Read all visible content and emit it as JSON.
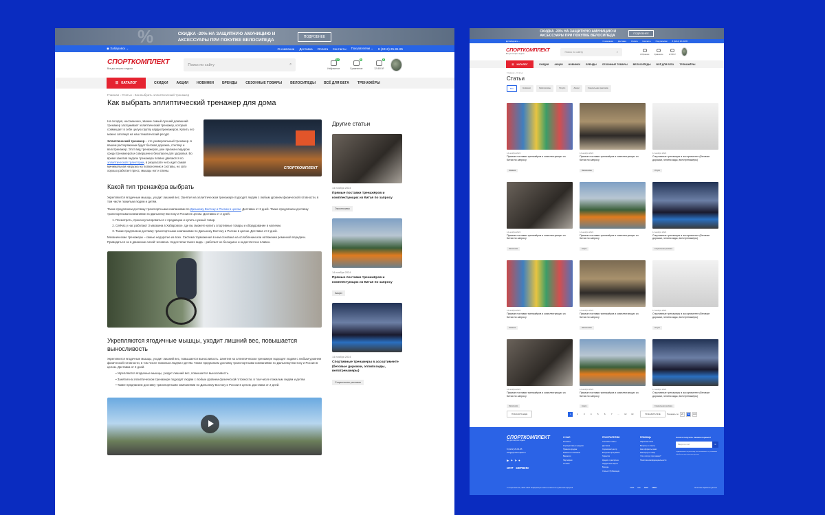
{
  "promo": {
    "text": "СКИДКА -20% НА ЗАЩИТНУЮ АМУНИЦИЮ И АКСЕССУАРЫ ПРИ ПОКУПКЕ ВЕЛОСИПЕДА",
    "button": "ПОДРОБНЕЕ"
  },
  "topbar": {
    "city": "Хабаровск",
    "links": [
      "О компании",
      "Доставка",
      "Оплата",
      "Контакты",
      "Покупателям"
    ],
    "phone": "8 (4212) 25-81-85"
  },
  "header": {
    "logo": "СПОРТКОМПЛЕКТ",
    "slogan": "Все для спорта и отдыха",
    "search_placeholder": "Поиск по сайту",
    "icons": [
      {
        "label": "Избранное",
        "count": "12"
      },
      {
        "label": "Сравнение",
        "count": "8"
      },
      {
        "label": "12 800 ₽",
        "count": "8"
      }
    ]
  },
  "nav": {
    "catalog": "КАТАЛОГ",
    "items": [
      "СКИДКИ",
      "АКЦИИ",
      "НОВИНКИ",
      "БРЕНДЫ",
      "СЕЗОННЫЕ ТОВАРЫ",
      "ВЕЛОСИПЕДЫ",
      "ВСЁ ДЛЯ БЕГА",
      "ТРЕНАЖЁРЫ"
    ]
  },
  "article": {
    "crumbs": "Главная  ›  Статьи  ›  Как выбрать эллиптический тренажер",
    "title": "Как выбрать эллиптический тренажер для дома",
    "intro1": "На сегодня, несомненно, звание самый лучший домашний тренажер заслуживает эллиптический тренажер, который совмещает в себе целую группу кардиотренажеров. Купить его можно заглянув на наш тематический ресурс",
    "intro2_bold": "Эллиптический тренажер",
    "intro2": " – это универсальный тренажер- в вашем распоряжении будет беговая дорожка, степпер и велотренажер. Этот вид тренажеров, уже признан лидером среди тренажеров и совершенно безопасен для здоровья. Во время занятия педали тренажера плавно двигаются по ",
    "intro2_link": "эллиптической траектории",
    "intro2_end": ", в результате чего идет самая минимальная нагрузка на позвоночник и суставы, но зато хорошо работает пресс, мышцы ног и спины.",
    "store_logo": "СПОРТКОМПЛЕКТ",
    "h2a": "Какой тип тренажёра выбрать",
    "p1": "Укрепляются ягодичные мышцы, уходит лишний вес. Занятия на эллиптическом тренажере подходят людям с любым уровнем физической готовности, в том числе пожилым людям и детям.",
    "p2a": "Также предлагаем доставку транспортными компаниями по ",
    "p2link": "Дальнему Востоку и России в целом.",
    "p2b": " Доставка от 2 дней. Также предлагаем доставку транспортными компаниями по Дальнему Востоку и России в целом. Доставка от 2 дней.",
    "ol": [
      "Посмотреть, проконсультироваться с продавцом и купить нужный товар.",
      "Сейчас у нас работают 3 магазина в Хабаровске, где вы сможете купить спортивные товары и оборудование в наличии.",
      "Также предлагаем доставку транспортными компаниями по Дальнему Востоку и России в целом. Доставка от 2 дней."
    ],
    "p3": "Механические тренажеры – самые недорогие из всех. Система торможения в нем основана на ослаблении или натяжении ременной передачи. Приводиться он в движение силой человека.  Недостатки такого вида – работает не бесшумно и недостаточно плавно.",
    "h2b": "Укрепляются ягодичные мышцы, уходит лишний вес, повышается выносливость",
    "p4": "Укрепляются ягодичные мышцы, уходит лишний вес, повышается выносливость. Занятия на эллиптическом тренажере подходят людям с любым уровнем физической готовности, в том числе пожилым людям и детям. Также предлагаем доставку транспортными компаниями по Дальнему Востоку и России в целом. Доставка от 2 дней.",
    "ul": [
      "Укрепляются ягодичные мышцы, уходит лишний вес, повышается выносливость.",
      "Занятия на эллиптическом тренажере подходят людям с любым уровнем физической готовности, в том числе пожилым людям и детям.",
      "Также предлагаем доставку транспортными компаниями по Дальнему Востоку и России в целом. Доставка от 2 дней."
    ]
  },
  "sidebar": {
    "title": "Другие статьи",
    "cards": [
      {
        "date": "14 ноября 2024",
        "title": "Прямые поставки тренажёров и комплектующих из Китая по запросу",
        "tag": "Эксклюзивы"
      },
      {
        "date": "14 ноября 2024",
        "title": "Прямые поставки тренажёров и комплектующих из Китая по запросу",
        "tag": "Акции"
      },
      {
        "date": "14 ноября 2024",
        "title": "Спортивные тренажеры в ассортименте (беговые дорожки, эллипсоиды, велотренажеры)",
        "tag": "Социальная реклама"
      }
    ]
  },
  "listing": {
    "crumbs": "Главная  ›  Статьи",
    "title": "Статьи",
    "filters": [
      "Все",
      "Новинки",
      "Эксклюзивы",
      "Услуги",
      "Акции",
      "Социальная реклама"
    ],
    "items": [
      {
        "date": "14 ноября 2024",
        "title": "Прямые поставки тренажёров и комплектующих из Китая по запросу",
        "tag": "Новинки"
      },
      {
        "date": "14 ноября 2024",
        "title": "Прямые поставки тренажёров и комплектующих из Китая по запросу",
        "tag": "Эксклюзивы"
      },
      {
        "date": "14 ноября 2024",
        "title": "Спортивные тренажеры в ассортименте (беговые дорожки, эллипсоиды, велотренажеры)",
        "tag": "Услуги"
      },
      {
        "date": "14 ноября 2024",
        "title": "Прямые поставки тренажёров и комплектующих из Китая по запросу",
        "tag": "Эксклюзив"
      },
      {
        "date": "14 ноября 2024",
        "title": "Прямые поставки тренажёров и комплектующих из Китая по запросу",
        "tag": "Акция"
      },
      {
        "date": "14 ноября 2024",
        "title": "Спортивные тренажеры в ассортименте (беговые дорожки, эллипсоиды, велотренажеры)",
        "tag": "Социальная реклама"
      },
      {
        "date": "14 ноября 2024",
        "title": "Прямые поставки тренажёров и комплектующих из Китая по запросу",
        "tag": "Новинки"
      },
      {
        "date": "14 ноября 2024",
        "title": "Прямые поставки тренажёров и комплектующих из Китая по запросу",
        "tag": "Эксклюзивы"
      },
      {
        "date": "14 ноября 2024",
        "title": "Спортивные тренажеры в ассортименте (беговые дорожки, эллипсоиды, велотренажеры)",
        "tag": "Услуги"
      },
      {
        "date": "14 ноября 2024",
        "title": "Прямые поставки тренажёров и комплектующих из Китая по запросу",
        "tag": "Эксклюзив"
      },
      {
        "date": "14 ноября 2024",
        "title": "Прямые поставки тренажёров и комплектующих из Китая по запросу",
        "tag": "Акция"
      },
      {
        "date": "14 ноября 2024",
        "title": "Спортивные тренажеры в ассортименте (беговые дорожки, эллипсоиды, велотренажеры)",
        "tag": "Социальная реклама"
      }
    ],
    "more": "ПОКАЗАТЬ ЕЩЁ",
    "pages": [
      "1",
      "2",
      "3",
      "4",
      "5",
      "6",
      "7",
      "...",
      "12",
      "13"
    ],
    "next": "ПОКАЗАТЬ ВСЁ",
    "show_label": "Показать по",
    "show_opts": [
      "20",
      "50",
      "100"
    ]
  },
  "footer": {
    "logo": "СПОРТКОМПЛЕКТ",
    "slogan": "Все для спорта и отдыха",
    "phone": "8 (4212) 25-81-85",
    "email": "info@sportkomplekt.ru",
    "opt": "ОПТ",
    "service": "СЕРВИС",
    "cols": [
      {
        "title": "О НАС",
        "items": [
          "Контакты",
          "Корпоративные продажи",
          "Правила продаж",
          "Реквизиты компании",
          "Вакансии",
          "Партнёрам",
          "Отзывы"
        ]
      },
      {
        "title": "ПОКУПАТЕЛЯМ",
        "items": [
          "Способы оплаты",
          "Доставка",
          "Сервисный центр",
          "Бонусная программа",
          "Гарантия",
          "Кредит и рассрочка",
          "Подарочные карты",
          "Бренды",
          "Статьи / Публикации"
        ]
      },
      {
        "title": "ПОМОЩЬ",
        "items": [
          "Обратная связь",
          "Вопросы и ответы",
          "Как оформить заказ",
          "Как вернуть товар",
          "Что я получу при заказе?",
          "Политика конфиденциальности"
        ]
      }
    ],
    "sub_title": "Хотите получить свежие первым?",
    "sub_placeholder": "Введите email",
    "sub_note": "Подписываясь на рассылку, вы соглашаетесь с условиями обработки персональных данных",
    "copyright": "© Спорткомплект, 2004–2024. Информация сайта не является публичной офертой",
    "pay": [
      "VISA",
      "MC",
      "МИР",
      "SBER"
    ],
    "privacy": "Политика обработки данных"
  }
}
